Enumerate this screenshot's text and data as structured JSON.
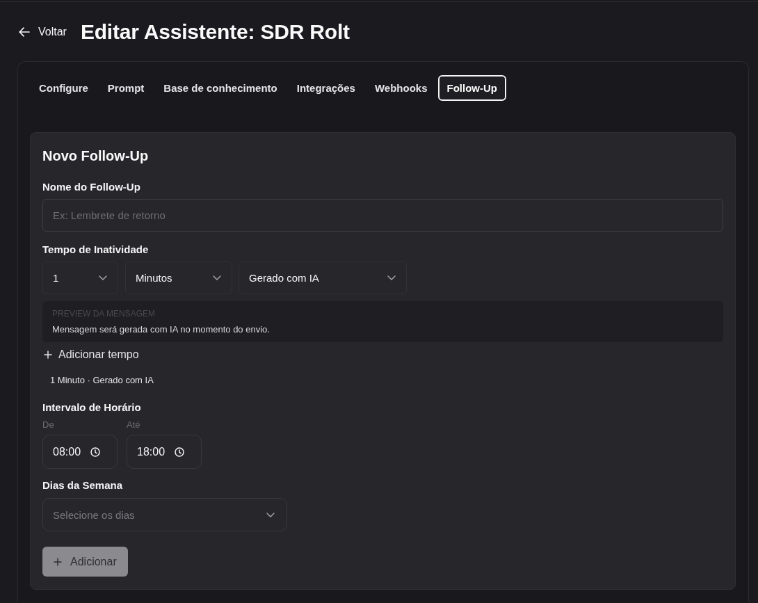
{
  "header": {
    "back_label": "Voltar",
    "title": "Editar Assistente: SDR Rolt"
  },
  "tabs": [
    {
      "label": "Configure",
      "selected": false
    },
    {
      "label": "Prompt",
      "selected": false
    },
    {
      "label": "Base de conhecimento",
      "selected": false
    },
    {
      "label": "Integrações",
      "selected": false
    },
    {
      "label": "Webhooks",
      "selected": false
    },
    {
      "label": "Follow-Up",
      "selected": true
    }
  ],
  "form": {
    "title": "Novo Follow-Up",
    "name_field": {
      "label": "Nome do Follow-Up",
      "placeholder": "Ex: Lembrete de retorno"
    },
    "inactivity": {
      "label": "Tempo de Inatividade",
      "selects": [
        {
          "value": "1"
        },
        {
          "value": "Minutos"
        },
        {
          "value": "Gerado com IA"
        }
      ],
      "preview": {
        "heading": "PREVIEW DA MENSAGEM",
        "text": "Mensagem será gerada com IA no momento do envio."
      },
      "add_time": "Adicionar tempo",
      "entries": [
        "1 Minuto · Gerado com IA"
      ]
    },
    "schedule": {
      "label": "Intervalo de Horário",
      "fields": [
        {
          "label": "De",
          "value": "08:00"
        },
        {
          "label": "Até",
          "value": "18:00"
        }
      ]
    },
    "weekdays": {
      "label": "Dias da Semana",
      "placeholder": "Selecione os dias"
    },
    "submit": {
      "label": "Adicionar",
      "disabled": true
    }
  }
}
